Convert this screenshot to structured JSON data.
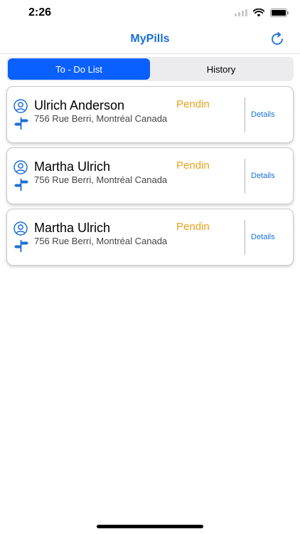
{
  "status_bar": {
    "time": "2:26"
  },
  "nav": {
    "title": "MyPills"
  },
  "tabs": [
    {
      "label": "To - Do List",
      "active": true
    },
    {
      "label": "History",
      "active": false
    }
  ],
  "orders": [
    {
      "name": "Ulrich Anderson",
      "address": "756 Rue Berri, Montréal Canada",
      "status": "Pendin",
      "details_label": "Details"
    },
    {
      "name": "Martha Ulrich",
      "address": "756 Rue Berri, Montréal Canada",
      "status": "Pendin",
      "details_label": "Details"
    },
    {
      "name": "Martha Ulrich",
      "address": "756 Rue Berri, Montréal Canada",
      "status": "Pendin",
      "details_label": "Details"
    }
  ],
  "colors": {
    "accent": "#1a6fd6",
    "active_tab": "#0a60ff",
    "pending": "#e6a21a"
  },
  "icons": {
    "refresh": "refresh-icon",
    "user": "user-circle-icon",
    "location": "signpost-icon"
  }
}
